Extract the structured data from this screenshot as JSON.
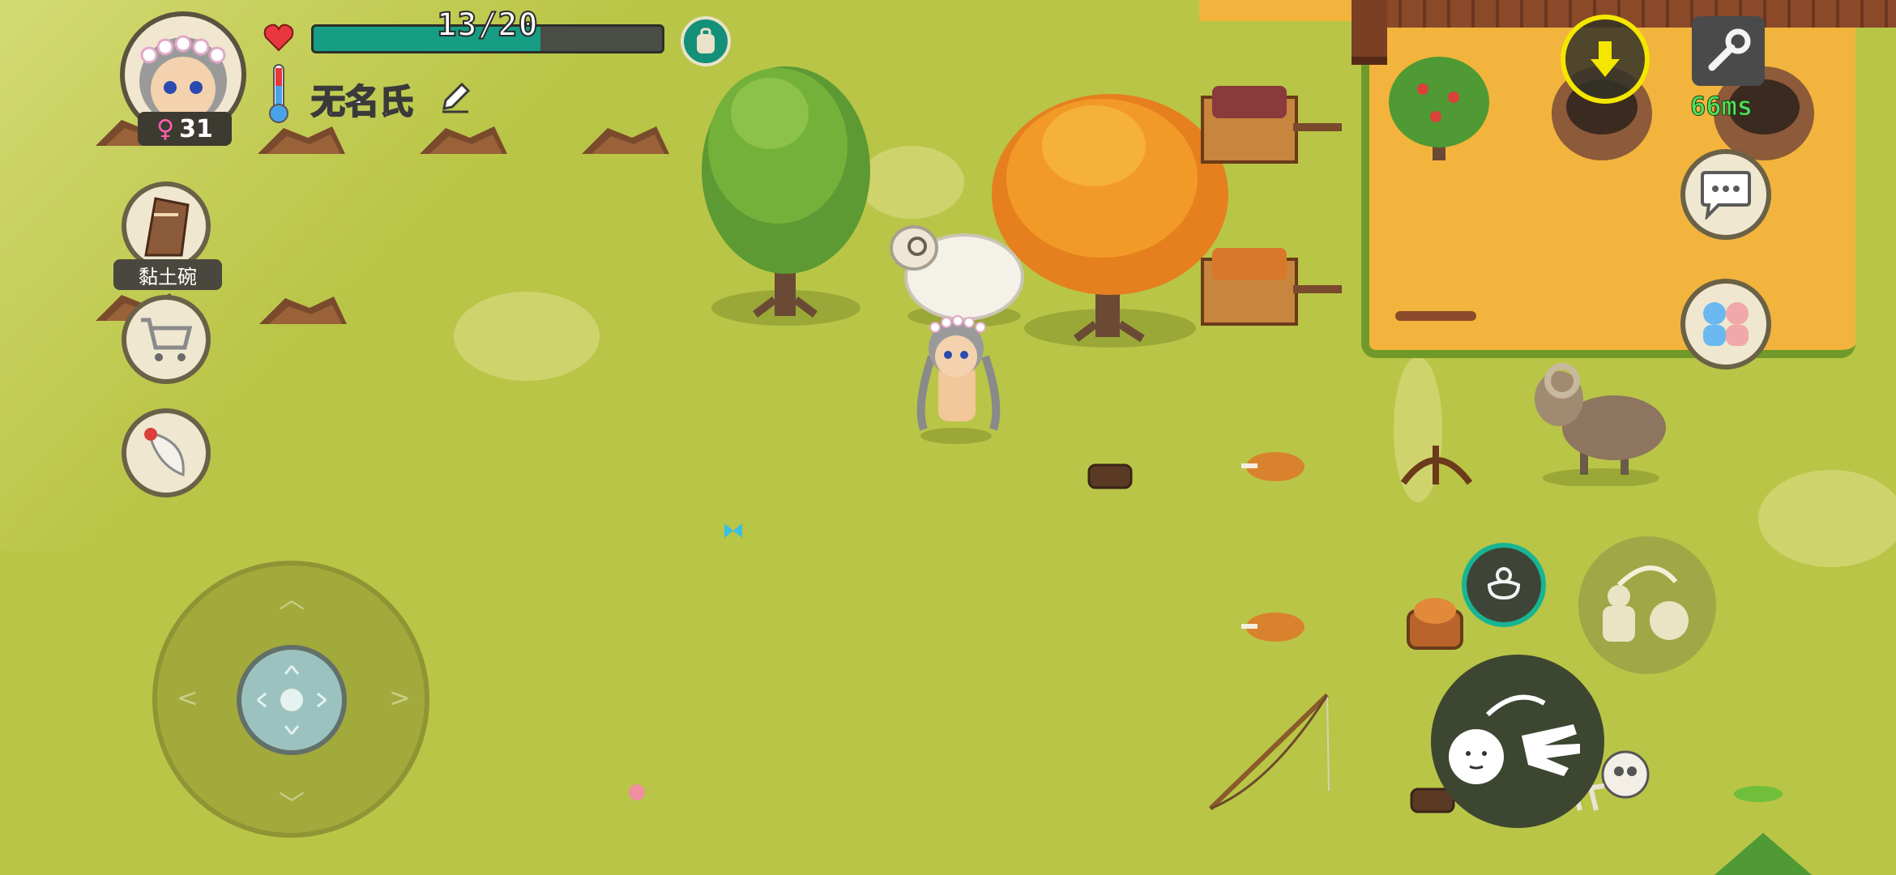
{
  "hud": {
    "health_text": "13/20",
    "health_fraction": 0.65,
    "player_name": "无名氏",
    "age": "31",
    "gender_symbol": "♀",
    "held_item_label": "黏土碗",
    "ping": "66ms"
  },
  "icons": {
    "health": "heart-icon",
    "temperature": "thermometer-icon",
    "rename": "pencil-icon",
    "backpack": "backpack-icon",
    "held_item": "clay-bowl-icon",
    "shop": "shopping-cart-icon",
    "feather": "feather-icon",
    "home_marker": "down-arrow-icon",
    "settings": "wrench-icon",
    "chat": "chat-bubble-icon",
    "social": "two-people-icon",
    "baby": "pacifier-icon",
    "swap": "swap-hands-icon",
    "interact": "grab-hand-icon"
  },
  "colors": {
    "grass": "#b9c546",
    "farm_soil": "#f2b43c",
    "health_fill": "#169d84",
    "ping_green": "#52e05a",
    "marker_yellow": "#f5e600"
  }
}
